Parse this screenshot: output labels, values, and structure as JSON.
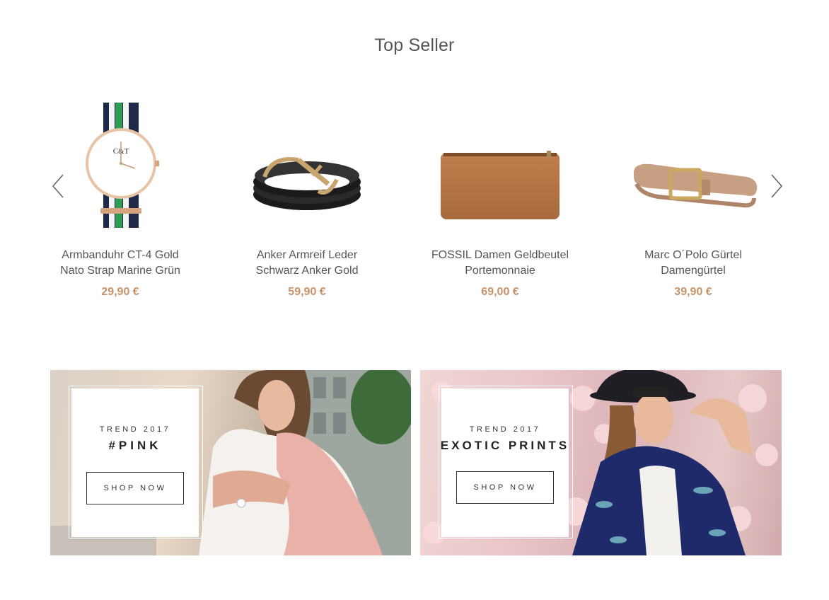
{
  "section": {
    "title": "Top Seller"
  },
  "carousel": {
    "prev_icon": "chevron-left-icon",
    "next_icon": "chevron-right-icon"
  },
  "products": [
    {
      "name_line1": "Armbanduhr CT-4 Gold",
      "name_line2": "Nato Strap Marine Grün",
      "price": "29,90 €",
      "image": "watch-image"
    },
    {
      "name_line1": "Anker Armreif Leder",
      "name_line2": "Schwarz Anker Gold",
      "price": "59,90 €",
      "image": "anchor-bracelet-image"
    },
    {
      "name_line1": "FOSSIL Damen Geldbeutel",
      "name_line2": "Portemonnaie",
      "price": "69,00 €",
      "image": "wallet-image"
    },
    {
      "name_line1": "Marc O´Polo Gürtel",
      "name_line2": "Damengürtel",
      "price": "39,90 €",
      "image": "belt-image"
    }
  ],
  "banners": [
    {
      "eyebrow": "TREND 2017",
      "headline": "#PINK",
      "button": "SHOP NOW",
      "image": "woman-pink-jacket-photo"
    },
    {
      "eyebrow": "TREND 2017",
      "headline": "EXOTIC PRINTS",
      "button": "SHOP NOW",
      "image": "woman-floral-blossom-photo"
    }
  ],
  "colors": {
    "price": "#c7926a",
    "title": "#555555",
    "text": "#555555"
  }
}
